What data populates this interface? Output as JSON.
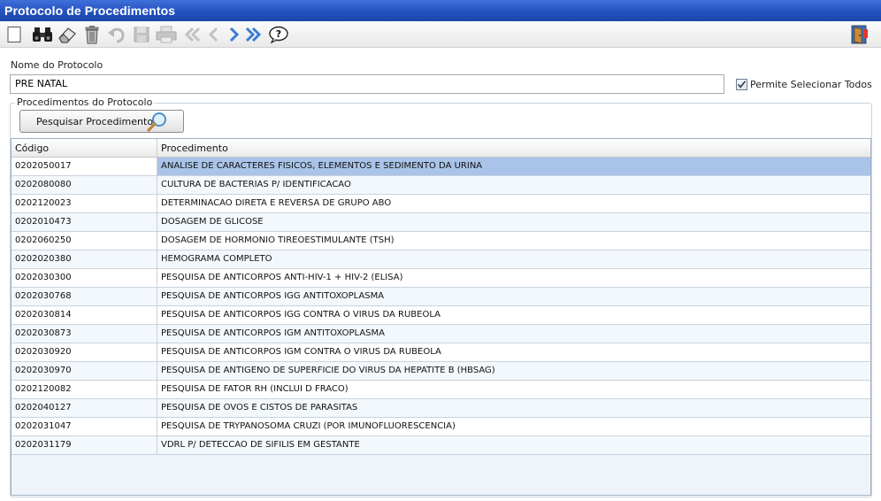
{
  "window": {
    "title": "Protocolo de Procedimentos"
  },
  "toolbar": {
    "buttons": [
      {
        "name": "new-icon"
      },
      {
        "name": "binoculars-icon"
      },
      {
        "name": "eraser-icon"
      },
      {
        "name": "trash-icon"
      },
      {
        "name": "undo-icon"
      },
      {
        "name": "save-icon"
      },
      {
        "name": "print-icon"
      },
      {
        "name": "first-icon"
      },
      {
        "name": "prev-icon"
      },
      {
        "name": "next-icon"
      },
      {
        "name": "last-icon"
      },
      {
        "name": "help-icon"
      },
      {
        "name": "exit-door-icon"
      }
    ]
  },
  "form": {
    "nome_label": "Nome do Protocolo",
    "nome_value": "PRE NATAL",
    "permite_label": "Permite Selecionar Todos",
    "permite_checked": true
  },
  "procedimentos": {
    "legend": "Procedimentos do Protocolo",
    "search_button": "Pesquisar Procedimentos",
    "columns": [
      "Código",
      "Procedimento"
    ],
    "rows": [
      [
        "0202050017",
        "ANALISE DE CARACTERES FISICOS, ELEMENTOS E SEDIMENTO DA URINA"
      ],
      [
        "0202080080",
        "CULTURA DE BACTERIAS P/ IDENTIFICACAO"
      ],
      [
        "0202120023",
        "DETERMINACAO DIRETA E REVERSA DE GRUPO ABO"
      ],
      [
        "0202010473",
        "DOSAGEM DE GLICOSE"
      ],
      [
        "0202060250",
        "DOSAGEM DE HORMONIO TIREOESTIMULANTE (TSH)"
      ],
      [
        "0202020380",
        "HEMOGRAMA COMPLETO"
      ],
      [
        "0202030300",
        "PESQUISA DE ANTICORPOS ANTI-HIV-1 + HIV-2 (ELISA)"
      ],
      [
        "0202030768",
        "PESQUISA DE ANTICORPOS IGG ANTITOXOPLASMA"
      ],
      [
        "0202030814",
        "PESQUISA DE ANTICORPOS IGG CONTRA O VIRUS DA RUBEOLA"
      ],
      [
        "0202030873",
        "PESQUISA DE ANTICORPOS IGM ANTITOXOPLASMA"
      ],
      [
        "0202030920",
        "PESQUISA DE ANTICORPOS IGM CONTRA O VIRUS DA RUBEOLA"
      ],
      [
        "0202030970",
        "PESQUISA DE ANTIGENO DE SUPERFICIE DO VIRUS DA HEPATITE B (HBSAG)"
      ],
      [
        "0202120082",
        "PESQUISA DE FATOR RH (INCLUI D FRACO)"
      ],
      [
        "0202040127",
        "PESQUISA DE OVOS E CISTOS DE PARASITAS"
      ],
      [
        "0202031047",
        "PESQUISA DE TRYPANOSOMA CRUZI (POR IMUNOFLUORESCENCIA)"
      ],
      [
        "0202031179",
        "VDRL P/ DETECCAO DE SIFILIS EM GESTANTE"
      ]
    ],
    "selected_row": 0
  },
  "colors": {
    "titlebar": "#2352bf",
    "selection": "#a9c4e8",
    "nav_blue": "#3a7bd5"
  }
}
